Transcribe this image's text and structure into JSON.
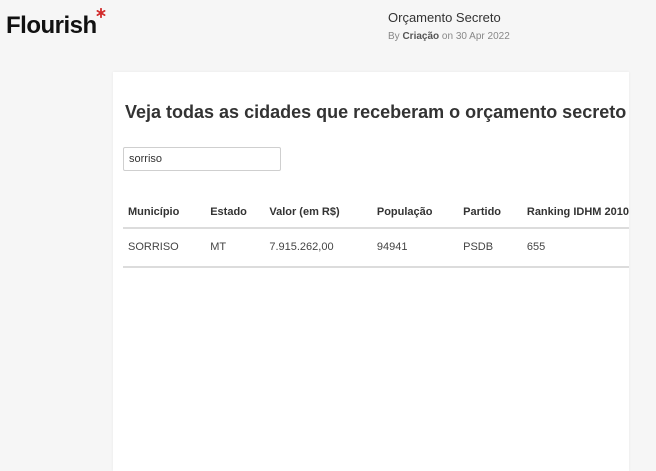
{
  "brand": {
    "logo_text": "Flourish"
  },
  "project": {
    "title": "Orçamento Secreto",
    "byline_prefix": "By",
    "author": "Criação",
    "byline_suffix": "on 30 Apr 2022"
  },
  "main": {
    "heading": "Veja todas as cidades que receberam o orçamento secreto",
    "search": {
      "value": "sorriso",
      "placeholder": ""
    },
    "table": {
      "headers": [
        "Município",
        "Estado",
        "Valor (em R$)",
        "População",
        "Partido",
        "Ranking IDHM 2010"
      ],
      "rows": [
        [
          "SORRISO",
          "MT",
          "7.915.262,00",
          "94941",
          "PSDB",
          "655"
        ]
      ]
    }
  },
  "colors": {
    "page_background": "#f6f6f6",
    "card_background": "#ffffff",
    "logo_accent": "#d22b2b"
  },
  "icons": {
    "logo_accent": "asterisk-icon"
  }
}
